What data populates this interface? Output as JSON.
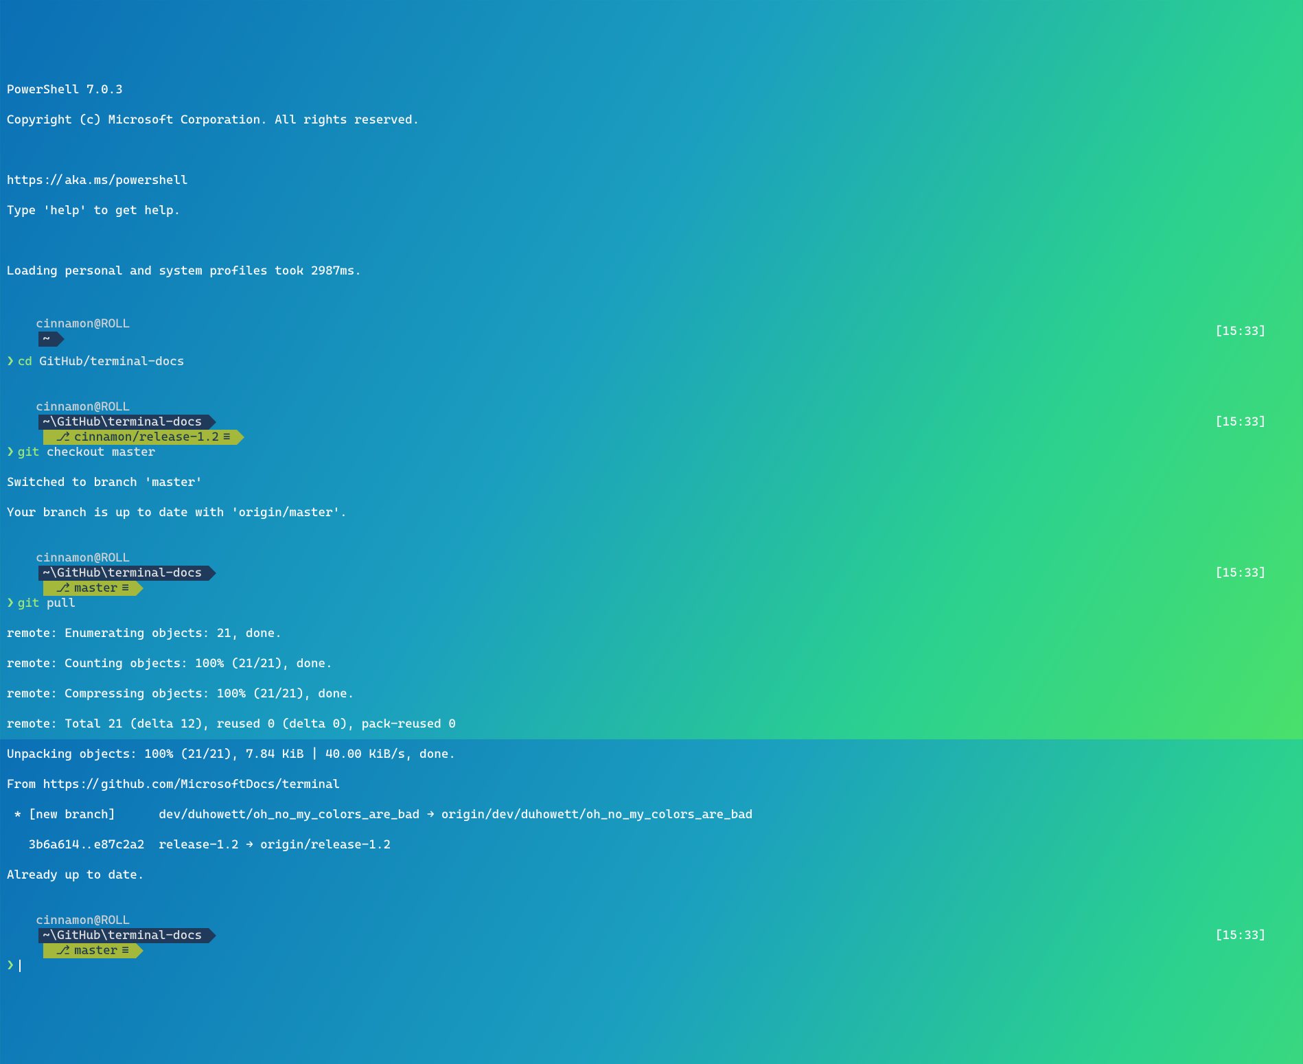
{
  "header": {
    "line1": "PowerShell 7.0.3",
    "line2": "Copyright (c) Microsoft Corporation. All rights reserved.",
    "blank1": "",
    "url": "https://aka.ms/powershell",
    "help": "Type 'help' to get help.",
    "blank2": "",
    "profiles": "Loading personal and system profiles took 2987ms."
  },
  "prompt_glyph": "❯",
  "user_host": "cinnamon@ROLL",
  "paths": {
    "home": "~",
    "repo": "~\\GitHub\\terminal-docs"
  },
  "branches": {
    "release": "cinnamon/release-1.2",
    "master": "master"
  },
  "branch_icon": "⎇",
  "branch_status": "≡",
  "timestamps": {
    "t1": "[15:33]",
    "t2": "[15:33]",
    "t3": "[15:33]",
    "t4": "[15:33]"
  },
  "commands": {
    "cd": {
      "cmd": "cd",
      "args": "GitHub/terminal-docs"
    },
    "checkout": {
      "cmd": "git",
      "args": "checkout master"
    },
    "pull": {
      "cmd": "git",
      "args": "pull"
    }
  },
  "output": {
    "switched": "Switched to branch 'master'",
    "uptodate_origin": "Your branch is up to date with 'origin/master'.",
    "enumerating": "remote: Enumerating objects: 21, done.",
    "counting": "remote: Counting objects: 100% (21/21), done.",
    "compressing": "remote: Compressing objects: 100% (21/21), done.",
    "total": "remote: Total 21 (delta 12), reused 0 (delta 0), pack-reused 0",
    "unpacking": "Unpacking objects: 100% (21/21), 7.84 KiB | 40.00 KiB/s, done.",
    "from": "From https://github.com/MicrosoftDocs/terminal",
    "newbranch": " * [new branch]      dev/duhowett/oh_no_my_colors_are_bad → origin/dev/duhowett/oh_no_my_colors_are_bad",
    "ff": "   3b6a614..e87c2a2  release-1.2 → origin/release-1.2",
    "already": "Already up to date."
  }
}
